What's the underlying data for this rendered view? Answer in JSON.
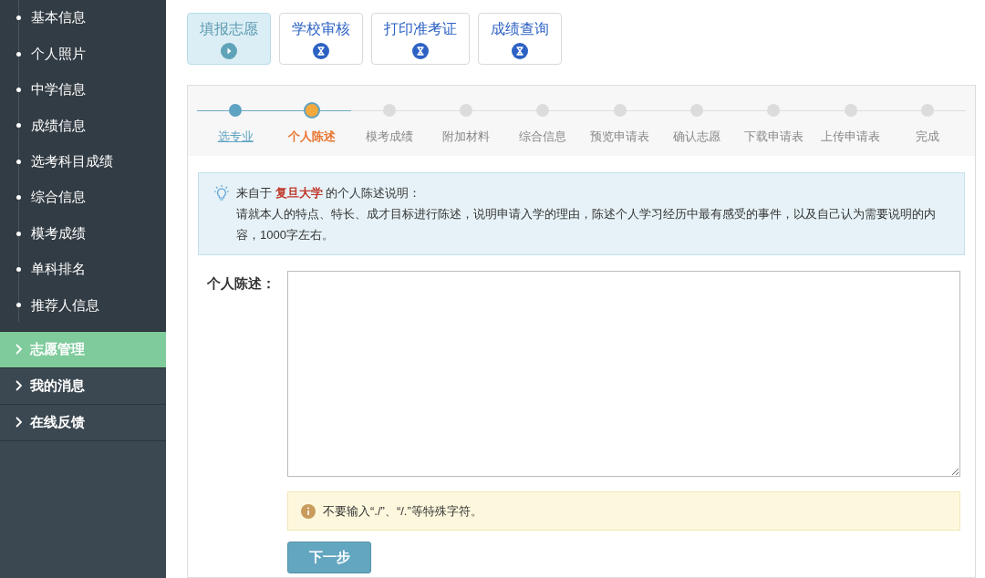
{
  "sidebar": {
    "sub_items": [
      "基本信息",
      "个人照片",
      "中学信息",
      "成绩信息",
      "选考科目成绩",
      "综合信息",
      "模考成绩",
      "单科排名",
      "推荐人信息"
    ],
    "menu": [
      {
        "label": "志愿管理",
        "selected": true
      },
      {
        "label": "我的消息",
        "selected": false
      },
      {
        "label": "在线反馈",
        "selected": false
      }
    ]
  },
  "tabs": [
    {
      "label": "填报志愿",
      "selected": true,
      "kind": "play"
    },
    {
      "label": "学校审核",
      "selected": false,
      "kind": "pending"
    },
    {
      "label": "打印准考证",
      "selected": false,
      "kind": "pending"
    },
    {
      "label": "成绩查询",
      "selected": false,
      "kind": "pending"
    }
  ],
  "steps": [
    {
      "label": "选专业",
      "done": true,
      "selected": false
    },
    {
      "label": "个人陈述",
      "done": false,
      "selected": true
    },
    {
      "label": "模考成绩",
      "done": false,
      "selected": false
    },
    {
      "label": "附加材料",
      "done": false,
      "selected": false
    },
    {
      "label": "综合信息",
      "done": false,
      "selected": false
    },
    {
      "label": "预览申请表",
      "done": false,
      "selected": false
    },
    {
      "label": "确认志愿",
      "done": false,
      "selected": false
    },
    {
      "label": "下载申请表",
      "done": false,
      "selected": false
    },
    {
      "label": "上传申请表",
      "done": false,
      "selected": false
    },
    {
      "label": "完成",
      "done": false,
      "selected": false
    }
  ],
  "notice": {
    "title": "来自于 **复旦大学** 的个人陈述说明：",
    "body": "请就本人的特点、特长、成才目标进行陈述，说明申请入学的理由，陈述个人学习经历中最有感受的事件，以及自己认为需要说明的内容，1000字左右。"
  },
  "form": {
    "label": "个人陈述：",
    "hint": "不要输入“./”、“/.”等特殊字符。",
    "button": "下一步"
  }
}
